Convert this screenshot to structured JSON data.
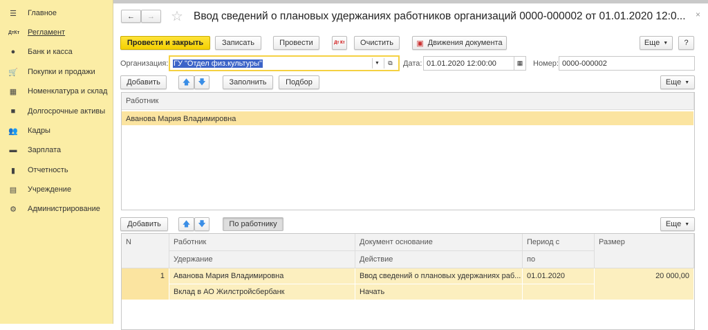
{
  "sidebar": {
    "items": [
      {
        "label": "Главное",
        "icon": "menu-icon"
      },
      {
        "label": "Регламент",
        "icon": "dt-kt-icon"
      },
      {
        "label": "Банк и касса",
        "icon": "bank-icon"
      },
      {
        "label": "Покупки и продажи",
        "icon": "cart-icon"
      },
      {
        "label": "Номенклатура и склад",
        "icon": "grid-icon"
      },
      {
        "label": "Долгосрочные активы",
        "icon": "truck-icon"
      },
      {
        "label": "Кадры",
        "icon": "people-icon"
      },
      {
        "label": "Зарплата",
        "icon": "wallet-icon"
      },
      {
        "label": "Отчетность",
        "icon": "chart-icon"
      },
      {
        "label": "Учреждение",
        "icon": "building-icon"
      },
      {
        "label": "Администрирование",
        "icon": "gear-icon"
      }
    ]
  },
  "header": {
    "title": "Ввод сведений о плановых удержаниях работников организаций 0000-000002 от 01.01.2020 12:0..."
  },
  "toolbar": {
    "post_close": "Провести и закрыть",
    "save": "Записать",
    "post": "Провести",
    "clear": "Очистить",
    "movements": "Движения документа",
    "more": "Еще",
    "help": "?",
    "dtkt": "Дт Кт"
  },
  "form": {
    "org_label": "Организация:",
    "org_value": "ГУ \"Отдел физ.культуры\"",
    "date_label": "Дата:",
    "date_value": "01.01.2020 12:00:00",
    "number_label": "Номер:",
    "number_value": "0000-000002"
  },
  "employees": {
    "add": "Добавить",
    "fill": "Заполнить",
    "pick": "Подбор",
    "more": "Еще",
    "column": "Работник",
    "rows": [
      "Аванова Мария Владимировна"
    ]
  },
  "deductions": {
    "add": "Добавить",
    "by_employee": "По работнику",
    "more": "Еще",
    "headers": {
      "n": "N",
      "employee": "Работник",
      "deduction": "Удержание",
      "doc": "Документ основание",
      "action": "Действие",
      "period_from": "Период с",
      "period_to": "по",
      "amount": "Размер"
    },
    "rows": [
      {
        "n": "1",
        "employee": "Аванова Мария Владимировна",
        "deduction": "Вклад в АО Жилстройсбербанк",
        "doc": "Ввод сведений о плановых удержаниях раб...",
        "action": "Начать",
        "period_from": "01.01.2020",
        "period_to": "",
        "amount": "20 000,00"
      }
    ]
  }
}
